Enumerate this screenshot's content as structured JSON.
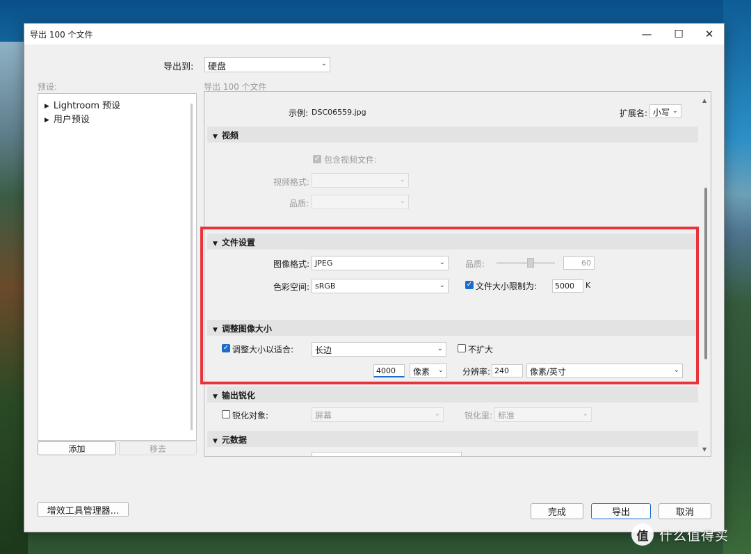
{
  "window": {
    "title": "导出 100 个文件",
    "minimize": "—",
    "maximize": "☐",
    "close": "✕"
  },
  "export_to": {
    "label": "导出到:",
    "value": "硬盘"
  },
  "presets": {
    "header": "预设:",
    "items": [
      {
        "label": "Lightroom 预设"
      },
      {
        "label": "用户预设"
      }
    ],
    "add_button": "添加",
    "remove_button": "移去"
  },
  "right_header": "导出 100 个文件",
  "filename": {
    "example_label": "示例:",
    "example_value": "DSC06559.jpg",
    "ext_label": "扩展名:",
    "ext_value": "小写"
  },
  "video": {
    "section_title": "视频",
    "include_label": "包含视频文件:",
    "include_checked": true,
    "format_label": "视频格式:",
    "format_value": "",
    "quality_label": "品质:",
    "quality_value": ""
  },
  "file_settings": {
    "section_title": "文件设置",
    "format_label": "图像格式:",
    "format_value": "JPEG",
    "quality_label": "品质:",
    "quality_value": "60",
    "colorspace_label": "色彩空间:",
    "colorspace_value": "sRGB",
    "limit_label": "文件大小限制为:",
    "limit_checked": true,
    "limit_value": "5000",
    "limit_unit": "K"
  },
  "resize": {
    "section_title": "调整图像大小",
    "fit_label": "调整大小以适合:",
    "fit_checked": true,
    "fit_value": "长边",
    "no_enlarge_label": "不扩大",
    "no_enlarge_checked": false,
    "size_value": "4000",
    "size_unit": "像素",
    "resolution_label": "分辨率:",
    "resolution_value": "240",
    "resolution_unit": "像素/英寸"
  },
  "sharpening": {
    "section_title": "输出锐化",
    "target_label": "锐化对象:",
    "target_checked": false,
    "target_value": "屏幕",
    "amount_label": "锐化里:",
    "amount_value": "标准"
  },
  "metadata": {
    "section_title": "元数据"
  },
  "footer": {
    "plugin_manager": "增效工具管理器...",
    "done": "完成",
    "export": "导出",
    "cancel": "取消"
  },
  "watermark": {
    "logo": "值",
    "text": "什么值得买"
  }
}
